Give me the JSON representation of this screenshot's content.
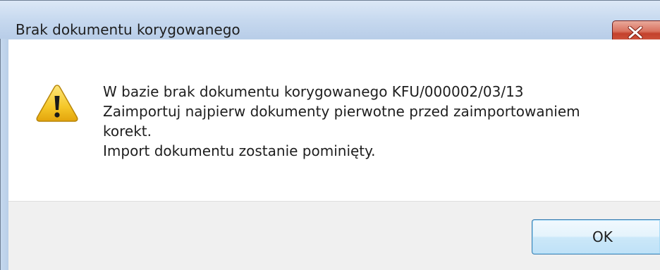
{
  "dialog": {
    "title": "Brak dokumentu korygowanego",
    "close_icon": "close-x-icon",
    "warning_icon": "warning-triangle-icon",
    "message_lines": [
      "W bazie brak dokumentu korygowanego KFU/000002/03/13",
      "Zaimportuj najpierw dokumenty pierwotne przed zaimportowaniem",
      "korekt.",
      "Import dokumentu zostanie pominięty."
    ],
    "ok_label": "OK"
  },
  "colors": {
    "titlebar": "#c7d9ef",
    "close_button": "#c4412c",
    "footer": "#f0f0f0",
    "ok_border": "#3c7fb1",
    "warning_yellow": "#f2c21b"
  }
}
